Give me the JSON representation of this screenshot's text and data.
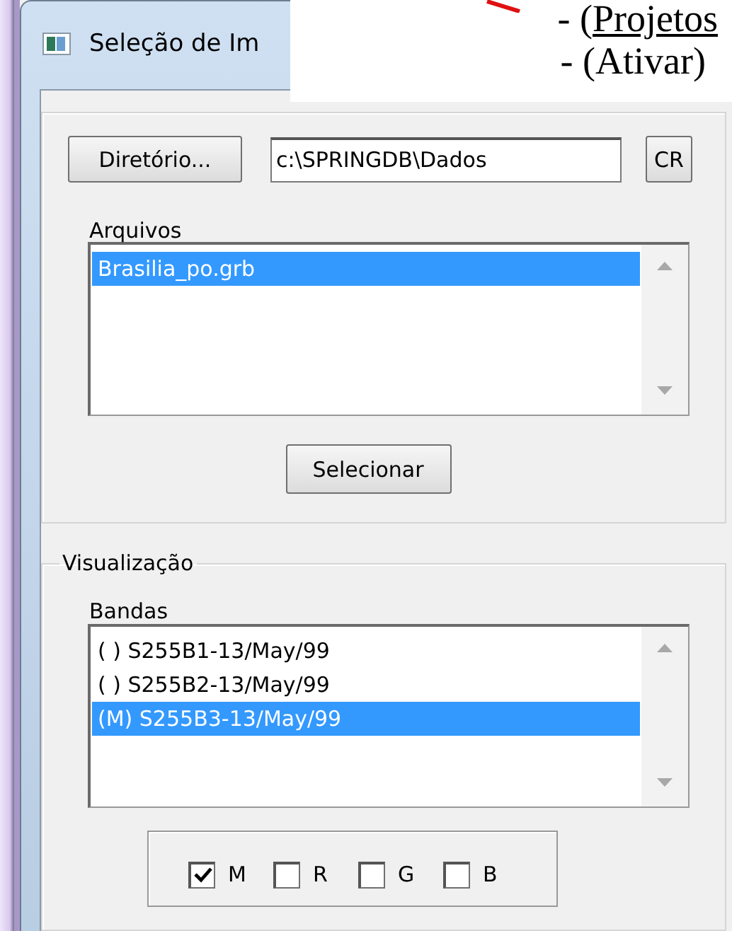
{
  "window": {
    "title": "Seleção de Im"
  },
  "callout": {
    "lines": [
      {
        "kind": "link",
        "prefix": "- (",
        "link": "Projetos"
      },
      {
        "kind": "plain",
        "text": "- (Ativar)"
      }
    ]
  },
  "directory": {
    "button": "Diretório...",
    "value": "c:\\SPRINGDB\\Dados",
    "cr_button": "CR"
  },
  "files": {
    "label": "Arquivos",
    "items": [
      {
        "text": "Brasilia_po.grb",
        "selected": true
      }
    ],
    "button": "Selecionar"
  },
  "visualization": {
    "title": "Visualização",
    "label": "Bandas",
    "items": [
      {
        "text": "( ) S255B1-13/May/99",
        "selected": false
      },
      {
        "text": "( ) S255B2-13/May/99",
        "selected": false
      },
      {
        "text": "(M) S255B3-13/May/99",
        "selected": true
      }
    ],
    "channels": [
      {
        "label": "M",
        "checked": true
      },
      {
        "label": "R",
        "checked": false
      },
      {
        "label": "G",
        "checked": false
      },
      {
        "label": "B",
        "checked": false
      }
    ]
  }
}
